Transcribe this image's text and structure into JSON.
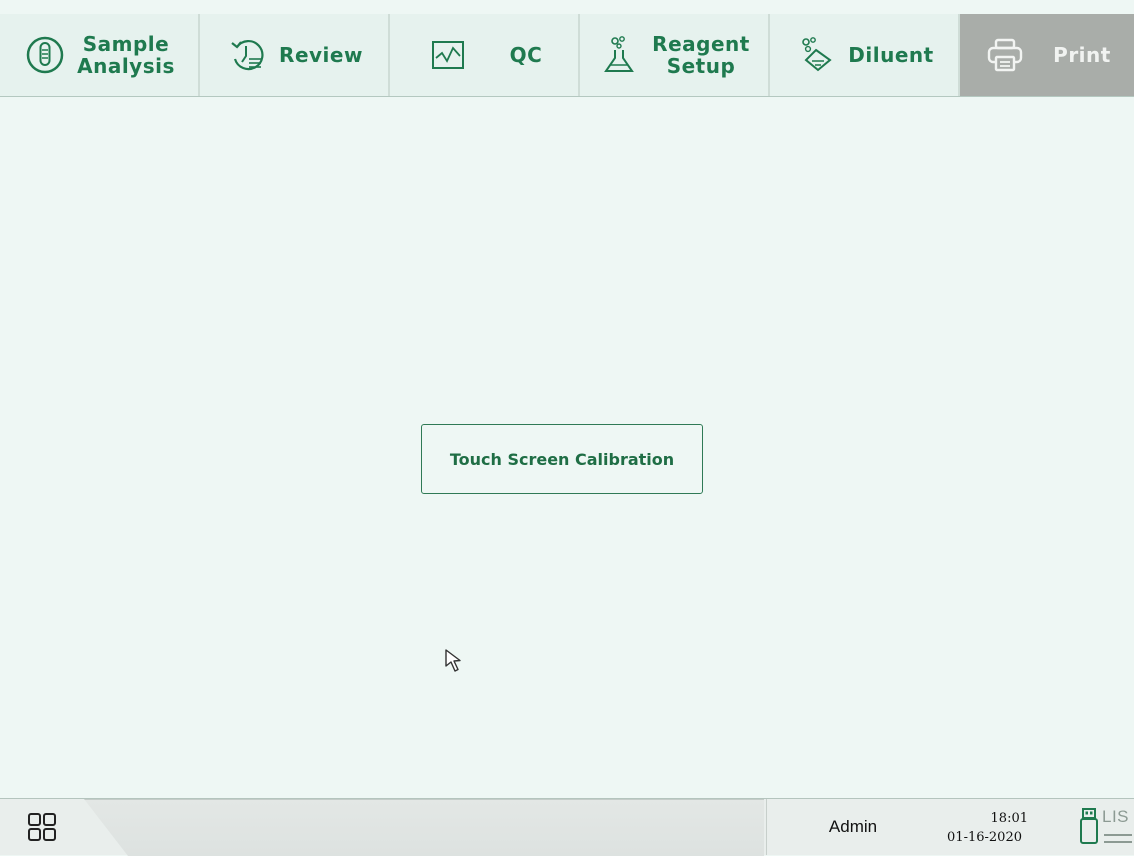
{
  "topbar": {
    "tabs": [
      {
        "label": "Sample\nAnalysis",
        "icon": "sample-tube-icon"
      },
      {
        "label": "Review",
        "icon": "review-history-icon"
      },
      {
        "label": "QC",
        "icon": "qc-chart-icon"
      },
      {
        "label": "Reagent\nSetup",
        "icon": "reagent-flask-icon"
      },
      {
        "label": "Diluent",
        "icon": "diluent-icon"
      },
      {
        "label": "Print",
        "icon": "printer-icon",
        "disabled": true
      }
    ]
  },
  "main": {
    "calibration_button": "Touch Screen Calibration"
  },
  "statusbar": {
    "user": "Admin",
    "time": "18:01",
    "date": "01-16-2020",
    "lis_label": "LIS"
  },
  "colors": {
    "accent": "#1f7a4f",
    "background": "#eef7f4",
    "tab_background": "#e6f2ee",
    "disabled_tab": "#a9ada9"
  }
}
